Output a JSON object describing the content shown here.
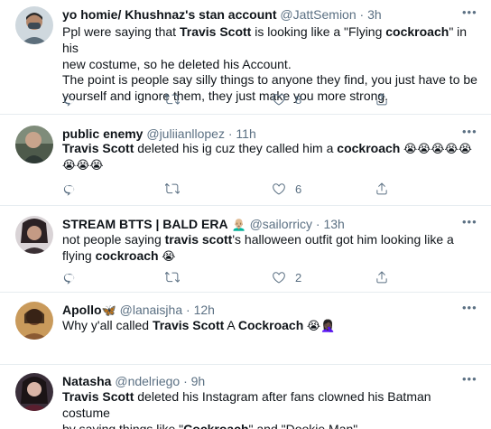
{
  "tweets": [
    {
      "name": "yo homie/ Khushnaz's stan account",
      "handle": "@JattSemion",
      "dot": "·",
      "time": "3h",
      "segments_line1": [
        "Ppl were saying  that ",
        "Travis Scott",
        " is looking like a \"Flying ",
        "cockroach",
        "\" in his"
      ],
      "line2": "new costume, so he deleted his Account.",
      "line3": "The point is people say silly things to anyone they find, you just have to be",
      "line4": "yourself and ignore them, they just make you more strong.",
      "reply_count": "",
      "retweet_count": "",
      "like_count": "8"
    },
    {
      "name": "public enemy",
      "handle": "@juliianllopez",
      "dot": "·",
      "time": "11h",
      "bold1": "Travis Scott",
      "text1": " deleted his ig cuz they called him a ",
      "bold2": "cockroach",
      "emoji1": " 😭😭😭😭😭",
      "emoji2": "😭😭😭",
      "like_count": "6"
    },
    {
      "name": "STREAM BTTS | BALD ERA",
      "name_emoji": "👨🏼‍🦲",
      "handle": "@sailorricy",
      "dot": "·",
      "time": "13h",
      "text1": "not people saying ",
      "bold1": "travis scott",
      "text2": "'s halloween outfit got him looking like a",
      "text3": "flying ",
      "bold2": "cockroach",
      "emoji1": " 😭",
      "like_count": "2"
    },
    {
      "name": "Apollo",
      "name_emoji": "🦋",
      "handle": "@lanaisjha",
      "dot": "·",
      "time": "12h",
      "text1": "Why y'all called ",
      "bold1": "Travis Scott",
      "text2": " A ",
      "bold2": "Cockroach",
      "emoji1": " 😭🤦🏿‍♀️"
    },
    {
      "name": "Natasha",
      "handle": "@ndelriego",
      "dot": "·",
      "time": "9h",
      "bold1": "Travis Scott",
      "text1": " deleted his Instagram after fans clowned his Batman costume",
      "text2": "by saying things like \"",
      "bold2": "Cockroach",
      "text3": "\" and \"Dookie Man\"."
    }
  ],
  "icons": {
    "reply": "reply-icon",
    "retweet": "retweet-icon",
    "like": "heart-icon",
    "share": "share-icon",
    "more": "more-icon"
  },
  "colors": {
    "text": "#0f1419",
    "secondary": "#5b7083",
    "divider": "#e6ecf0"
  }
}
